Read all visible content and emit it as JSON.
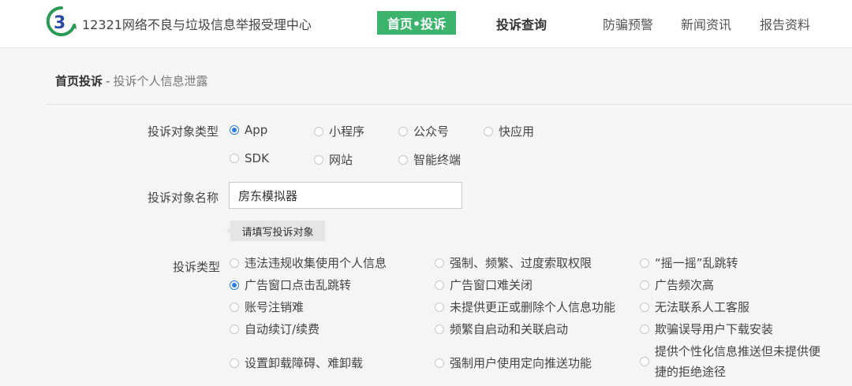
{
  "header": {
    "site_title": "12321网络不良与垃圾信息举报受理中心",
    "nav": {
      "home_complaint": "首页•投诉",
      "complaint_query": "投诉查询",
      "fraud_alert": "防骗预警",
      "news": "新闻资讯",
      "reports": "报告资料"
    },
    "accent": "#3cb46e"
  },
  "breadcrumb": {
    "home": "首页投诉",
    "sep": "-",
    "current": "投诉个人信息泄露"
  },
  "form": {
    "target_type": {
      "label": "投诉对象类型",
      "options": [
        {
          "label": "App",
          "checked": true
        },
        {
          "label": "小程序",
          "checked": false
        },
        {
          "label": "公众号",
          "checked": false
        },
        {
          "label": "快应用",
          "checked": false
        },
        {
          "label": "SDK",
          "checked": false
        },
        {
          "label": "网站",
          "checked": false
        },
        {
          "label": "智能终端",
          "checked": false
        }
      ]
    },
    "target_name": {
      "label": "投诉对象名称",
      "value": "房东模拟器",
      "hint": "请填写投诉对象"
    },
    "complaint_type": {
      "label": "投诉类型",
      "options": [
        {
          "label": "违法违规收集使用个人信息",
          "checked": false
        },
        {
          "label": "强制、频繁、过度索取权限",
          "checked": false
        },
        {
          "label": "“摇一摇”乱跳转",
          "checked": false
        },
        {
          "label": "广告窗口点击乱跳转",
          "checked": true
        },
        {
          "label": "广告窗口难关闭",
          "checked": false
        },
        {
          "label": "广告频次高",
          "checked": false
        },
        {
          "label": "账号注销难",
          "checked": false
        },
        {
          "label": "未提供更正或删除个人信息功能",
          "checked": false
        },
        {
          "label": "无法联系人工客服",
          "checked": false
        },
        {
          "label": "自动续订/续费",
          "checked": false
        },
        {
          "label": "频繁自启动和关联启动",
          "checked": false
        },
        {
          "label": "欺骗误导用户下载安装",
          "checked": false
        },
        {
          "label": "设置卸载障碍、难卸载",
          "checked": false
        },
        {
          "label": "强制用户使用定向推送功能",
          "checked": false
        },
        {
          "label": "提供个性化信息推送但未提供便捷的拒绝途径",
          "checked": false
        }
      ]
    }
  }
}
